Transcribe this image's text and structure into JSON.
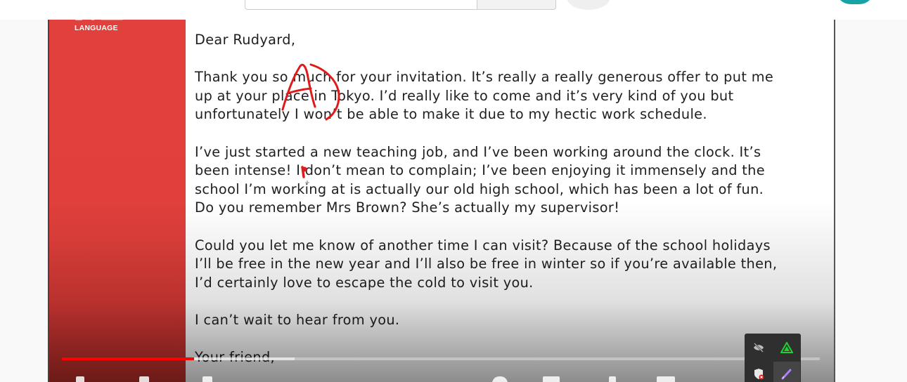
{
  "browser": {
    "search_placeholder": ""
  },
  "sidebar": {
    "logo_label": "LANGUAGE"
  },
  "letter": {
    "greeting": "Dear Rudyard,",
    "paragraph1": [
      "Thank you so much for your invitation. It’s really a really generous offer to put me",
      "up at your place in Tokyo. I’d really like to come and it’s very kind of you but",
      "unfortunately I won’t be able to make it due to my hectic work schedule."
    ],
    "paragraph2": [
      "I’ve just started a new teaching job, and I’ve been working around the clock. It’s",
      "been intense! I don’t mean to complain; I’ve been enjoying it immensely and the",
      "school I’m working at is actually our old high school, which has been a lot of fun.",
      "Do you remember Mrs Brown? She’s actually my supervisor!"
    ],
    "paragraph3": [
      "Could you let me know of another time I can visit? Because of the school holidays",
      "I’ll be free in the new year and I’ll also be free in winter so if you’re available then,",
      "I’d certainly love to escape the cold to visit you."
    ],
    "paragraph4": "I can’t wait to hear from you.",
    "closing": "Your friend,"
  },
  "annotation": {
    "mark": "A",
    "color": "#e01a1a"
  },
  "player": {
    "progress_played": 0.174,
    "progress_buffered": 0.307,
    "played_color": "#ff0000"
  },
  "tools": {
    "items": [
      "hide-annotations-icon",
      "highlighter-icon",
      "shield-icon",
      "pen-icon"
    ]
  },
  "colors": {
    "brand_red": "#e2403c",
    "avatar_teal": "#16a3a8"
  }
}
